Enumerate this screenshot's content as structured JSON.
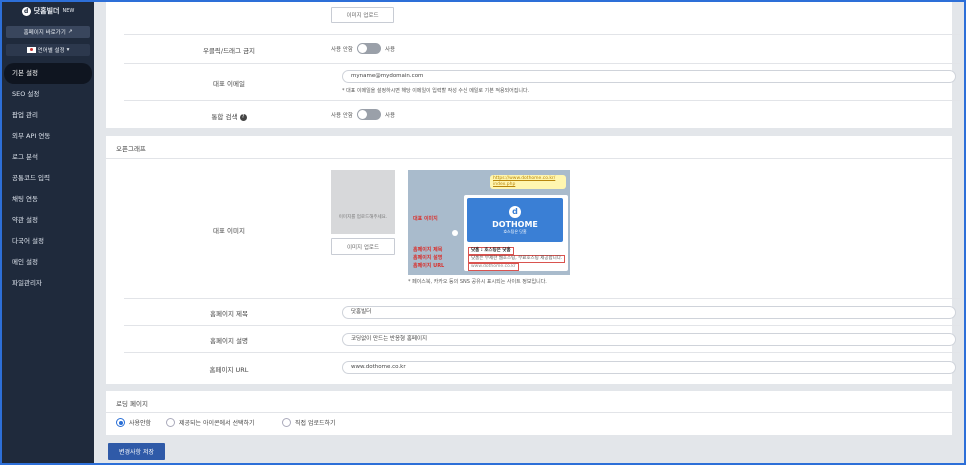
{
  "sidebar": {
    "brand": "닷홈빌더",
    "brand_badge": "NEW",
    "homepage_button": "홈페이지 바로가기",
    "language_button": "언어별 설정",
    "items": [
      {
        "label": "기본 설정",
        "active": true
      },
      {
        "label": "SEO 설정"
      },
      {
        "label": "팝업 관리"
      },
      {
        "label": "외부 API 연동"
      },
      {
        "label": "로그 분석"
      },
      {
        "label": "공통코드 입력"
      },
      {
        "label": "채팅 연동"
      },
      {
        "label": "약관 설정"
      },
      {
        "label": "다국어 설정"
      },
      {
        "label": "메인 설정"
      },
      {
        "label": "파일관리자"
      }
    ]
  },
  "top": {
    "upload_button": "이미지 업로드",
    "rightclick": {
      "label": "우클릭/드래그 금지",
      "off_label": "사용 안함",
      "on_label": "사용"
    },
    "email": {
      "label": "대표 이메일",
      "value": "myname@mydomain.com",
      "note": "* 대표 이메일을 설정하시면 해당 이메일이 입력할 작성 수신 메일로 기본 적용되어집니다."
    },
    "search": {
      "label": "통합 검색",
      "off_label": "사용 안함",
      "on_label": "사용"
    }
  },
  "og": {
    "section_title": "오픈그래프",
    "image_label": "대표 이미지",
    "placeholder_text": "이미지를 업로드해주세요.",
    "upload_button": "이미지 업로드",
    "preview": {
      "url": "https://www.dothome.co.kr/ index.php",
      "logo_name": "DOTHOME",
      "logo_sub": "호스팅은 닷홈",
      "line_title": "닷홈 : 호스팅은 닷홈",
      "line_desc": "닷홈은 무제한 웹호스팅, 무료호스팅 제공합니다.",
      "line_url": "www.dothome.co.kr",
      "callout_image": "대표 이미지",
      "callout_title": "홈페이지 제목",
      "callout_desc": "홈페이지 설명",
      "callout_url": "홈페이지 URL"
    },
    "note": "* 페이스북, 카카오 등의 SNS 공유시 표시되는 사이트 정보입니다.",
    "title_label": "홈페이지 제목",
    "title_value": "닷홈빌더",
    "desc_label": "홈페이지 설명",
    "desc_value": "코딩없이 만드는 반응형 홈페이지",
    "url_label": "홈페이지 URL",
    "url_value": "www.dothome.co.kr"
  },
  "loading": {
    "section_title": "로딩 페이지",
    "options": [
      "사용안함",
      "제공되는 아이콘에서 선택하기",
      "직접 업로드하기"
    ],
    "selected": 0
  },
  "save_button": "변경사항 저장"
}
